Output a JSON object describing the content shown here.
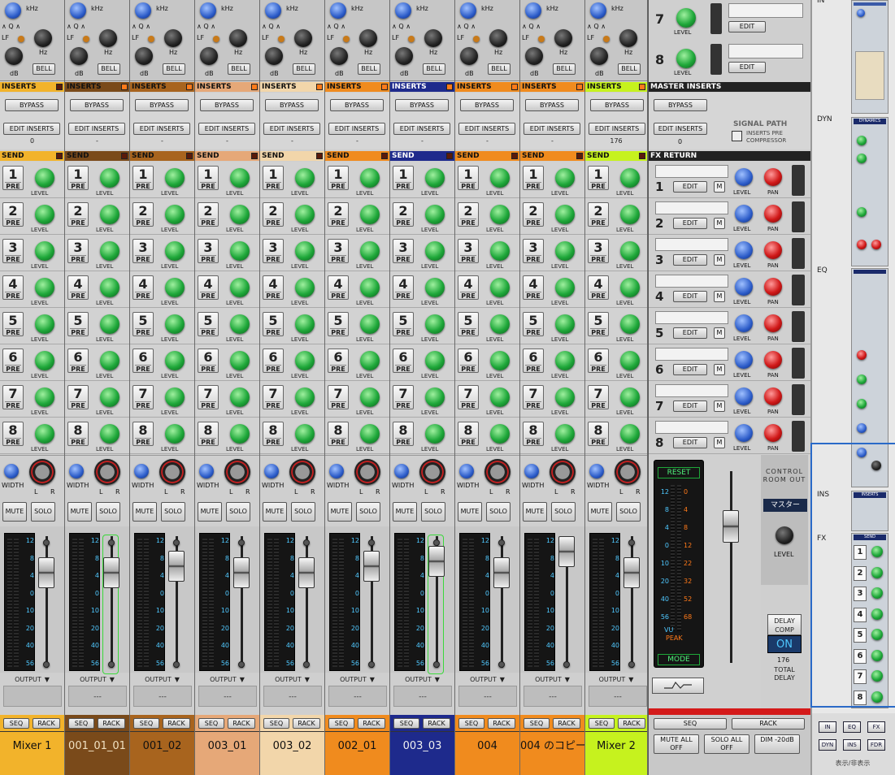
{
  "channels": [
    {
      "name": "Mixer 1",
      "color": "#f2b32b",
      "ins_color": "#f2b32b",
      "send_color": "#f2b32b",
      "ins_value": "0",
      "output_value": "",
      "hl": false,
      "fader": 38
    },
    {
      "name": "001_01_01",
      "color": "#7a4a1a",
      "ins_color": "#7a4a1a",
      "send_color": "#7a4a1a",
      "ins_value": "-",
      "output_value": "---",
      "hl": true,
      "fader": 38
    },
    {
      "name": "001_02",
      "color": "#a8641e",
      "ins_color": "#a8641e",
      "send_color": "#a8641e",
      "ins_value": "-",
      "output_value": "---",
      "hl": false,
      "fader": 30
    },
    {
      "name": "003_01",
      "color": "#e6a878",
      "ins_color": "#e6a878",
      "send_color": "#e6a878",
      "ins_value": "-",
      "output_value": "---",
      "hl": false,
      "fader": 38
    },
    {
      "name": "003_02",
      "color": "#f2d6aa",
      "ins_color": "#f2d6aa",
      "send_color": "#f2d6aa",
      "ins_value": "-",
      "output_value": "---",
      "hl": false,
      "fader": 38
    },
    {
      "name": "002_01",
      "color": "#f08b1e",
      "ins_color": "#f08b1e",
      "send_color": "#f08b1e",
      "ins_value": "-",
      "output_value": "---",
      "hl": false,
      "fader": 30
    },
    {
      "name": "003_03",
      "color": "#1e2a8c",
      "ins_color": "#1e2a8c",
      "send_color": "#1e2a8c",
      "ins_value": "-",
      "output_value": "---",
      "hl": true,
      "fader": 24
    },
    {
      "name": "004",
      "color": "#f08b1e",
      "ins_color": "#f08b1e",
      "send_color": "#f08b1e",
      "ins_value": "-",
      "output_value": "---",
      "hl": false,
      "fader": 38
    },
    {
      "name": "004 のコピー",
      "color": "#f08b1e",
      "ins_color": "#f08b1e",
      "send_color": "#f08b1e",
      "ins_value": "-",
      "output_value": "---",
      "hl": false,
      "fader": 12
    },
    {
      "name": "Mixer 2",
      "color": "#c6f21e",
      "ins_color": "#c6f21e",
      "send_color": "#c6f21e",
      "ins_value": "176",
      "output_value": "---",
      "hl": false,
      "fader": 38
    }
  ],
  "labels": {
    "inserts": "INSERTS",
    "bypass": "BYPASS",
    "edit_inserts": "EDIT INSERTS",
    "send": "SEND",
    "pre": "PRE",
    "level": "LEVEL",
    "width": "WIDTH",
    "l": "L",
    "r": "R",
    "mute": "MUTE",
    "solo": "SOLO",
    "output": "OUTPUT",
    "seq": "SEQ",
    "rack": "RACK",
    "bell": "BELL",
    "khz": "kHz",
    "hz": "Hz",
    "db": "dB",
    "lf": "LF",
    "q": "∧ Q ∧"
  },
  "send_numbers": [
    "1",
    "2",
    "3",
    "4",
    "5",
    "6",
    "7",
    "8"
  ],
  "meter_scale": [
    "12",
    "8",
    "4",
    "0",
    "10",
    "20",
    "40",
    "56"
  ],
  "master": {
    "top_levels": [
      "7",
      "8"
    ],
    "edit": "EDIT",
    "m": "M",
    "level": "LEVEL",
    "pan": "PAN",
    "master_inserts": "MASTER INSERTS",
    "bypass": "BYPASS",
    "edit_inserts": "EDIT INSERTS",
    "ins_value": "0",
    "signal_path": "SIGNAL PATH",
    "inserts_pre": "INSERTS PRE",
    "compressor": "COMPRESSOR",
    "fx_return": "FX RETURN",
    "fx_numbers": [
      "1",
      "2",
      "3",
      "4",
      "5",
      "6",
      "7",
      "8"
    ],
    "reset": "RESET",
    "vu_left": [
      "12",
      "8",
      "4",
      "0",
      "10",
      "20",
      "40",
      "56"
    ],
    "vu_right": [
      "0",
      "4",
      "8",
      "12",
      "22",
      "32",
      "52",
      "68"
    ],
    "vu": "VU",
    "peak": "PEAK",
    "mode": "MODE",
    "control_room": "CONTROL ROOM OUT",
    "master_label": "マスター",
    "cr_level": "LEVEL",
    "delay_comp": "DELAY COMP",
    "on": "ON",
    "delay_value": "176",
    "total_delay": "TOTAL DELAY",
    "seq": "SEQ",
    "rack": "RACK",
    "mute_all": "MUTE ALL OFF",
    "solo_all": "SOLO ALL OFF",
    "dim": "DIM -20dB"
  },
  "rack": {
    "sections": [
      {
        "label": "IN"
      },
      {
        "label": "DYN"
      },
      {
        "label": "EQ"
      },
      {
        "label": "INS"
      },
      {
        "label": "FX"
      }
    ],
    "buttons": [
      "IN",
      "EQ",
      "FX",
      "DYN",
      "INS",
      "FDR"
    ],
    "footer": "表示/非表示",
    "dyn_title": "DYNAMICS",
    "ins_title": "INSERTS",
    "send_title": "SEND",
    "send_numbers": [
      "1",
      "2",
      "3",
      "4",
      "5",
      "6",
      "7",
      "8"
    ]
  }
}
